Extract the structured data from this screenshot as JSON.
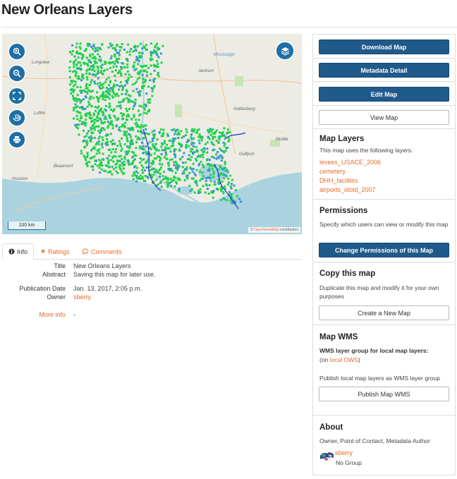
{
  "page": {
    "title": "New Orleans Layers"
  },
  "map": {
    "scale_label": "100 km",
    "attribution_prefix": "© ",
    "attribution_link": "OpenStreetMap",
    "attribution_suffix": " contributors",
    "labels": {
      "mississippi": "Mississippi",
      "jackson": "Jackson",
      "hattiesburg": "Hattiesburg",
      "mobile": "Mobile",
      "gulfport": "Gulfport",
      "longview": "Longview",
      "lufkin": "Lufkin",
      "beaumont": "Beaumont",
      "houston": "Houston"
    },
    "controls": [
      "zoom-in-icon",
      "zoom-out-icon",
      "fullscreen-icon",
      "3d-icon",
      "print-icon"
    ],
    "layers_control_icon": "layers-icon",
    "colors": {
      "points_green": "#1fd14a",
      "points_blue": "#3a8fd8",
      "water": "#aad3df"
    }
  },
  "tabs": [
    {
      "label": "Info",
      "icon": "info-icon",
      "active": true
    },
    {
      "label": "Ratings",
      "icon": "star-icon",
      "active": false
    },
    {
      "label": "Comments",
      "icon": "comment-icon",
      "active": false
    }
  ],
  "info": {
    "title_label": "Title",
    "title_value": "New Orleans Layers",
    "abstract_label": "Abstract",
    "abstract_value": "Saving this map for later use.",
    "pubdate_label": "Publication Date",
    "pubdate_value": "Jan. 13, 2017, 2:05 p.m.",
    "owner_label": "Owner",
    "owner_value": "sberry",
    "more_label": "More info",
    "more_value": "-"
  },
  "sidebar": {
    "download_label": "Download Map",
    "metadata_label": "Metadata Detail",
    "edit_label": "Edit Map",
    "view_label": "View Map",
    "layers": {
      "title": "Map Layers",
      "text": "This map uses the following layers:",
      "items": [
        "levees_USACE_2006",
        "cemetery",
        "DHH_facilites",
        "airports_idotd_2007"
      ]
    },
    "permissions": {
      "title": "Permissions",
      "text": "Specify which users can view or modify this map",
      "button": "Change Permissions of this Map"
    },
    "copy": {
      "title": "Copy this map",
      "text": "Duplicate this map and modify it for your own purposes",
      "button": "Create a New Map"
    },
    "wms": {
      "title": "Map WMS",
      "subtitle": "WMS layer group for local map layers:",
      "on_prefix": "(on ",
      "on_link": "local OWS",
      "on_suffix": ")",
      "text": "Publish local map layers as WMS layer group",
      "button": "Publish Map WMS"
    },
    "about": {
      "title": "About",
      "roles": "Owner, Point of Contact, Metadata Author",
      "user": "sberry",
      "group": "No Group"
    }
  },
  "accent_color": "#e86a25",
  "primary_color": "#1f5a8a"
}
